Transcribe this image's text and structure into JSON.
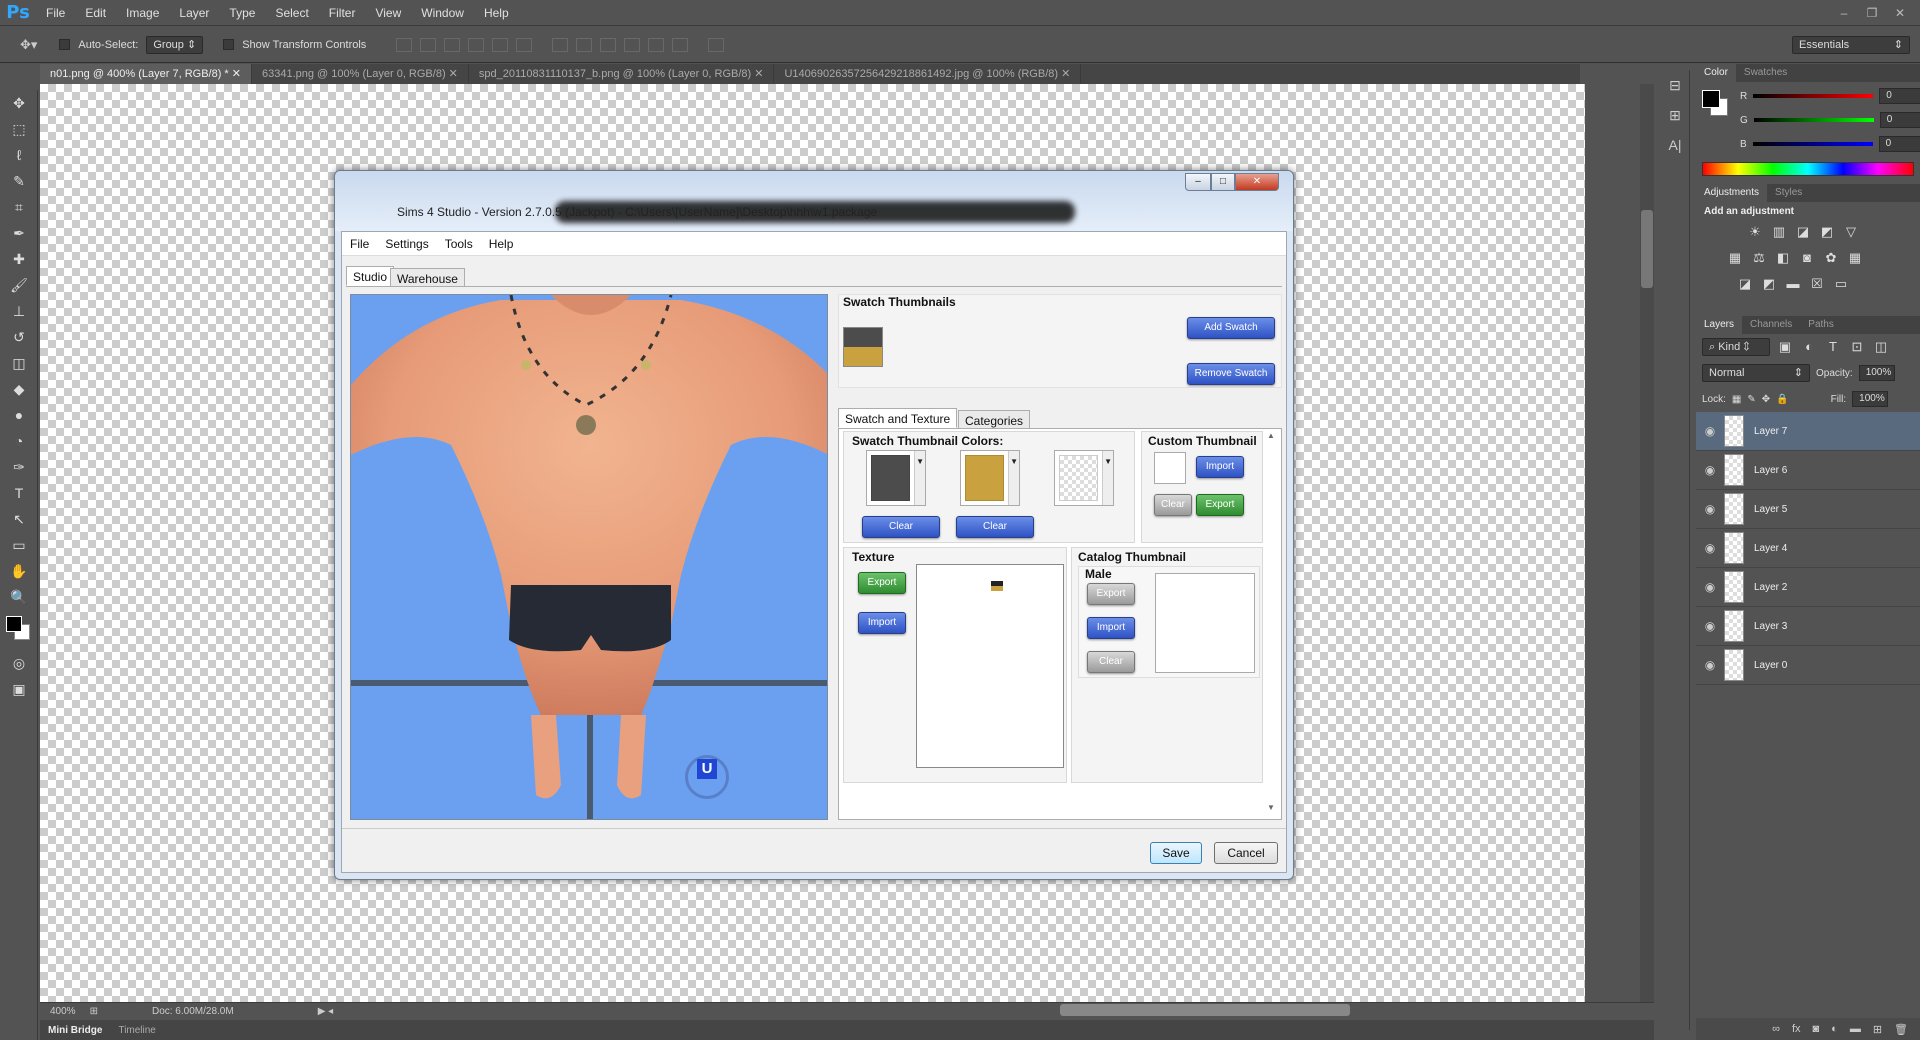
{
  "app": {
    "logo": "Ps",
    "menu": [
      "File",
      "Edit",
      "Image",
      "Layer",
      "Type",
      "Select",
      "Filter",
      "View",
      "Window",
      "Help"
    ],
    "window_controls": [
      "–",
      "❐",
      "✕"
    ]
  },
  "options_bar": {
    "auto_select_label": "Auto-Select:",
    "auto_select_value": "Group",
    "show_transform_label": "Show Transform Controls",
    "workspace": "Essentials"
  },
  "doc_tabs": [
    {
      "label": "n01.png @ 400% (Layer 7, RGB/8) *",
      "active": true
    },
    {
      "label": "63341.png @ 100% (Layer 0, RGB/8)",
      "active": false
    },
    {
      "label": "spd_20110831110137_b.png @ 100% (Layer 0, RGB/8)",
      "active": false
    },
    {
      "label": "U14069026357256429218861492.jpg @ 100% (RGB/8)",
      "active": false
    }
  ],
  "status": {
    "zoom": "400%",
    "doc": "Doc: 6.00M/28.0M"
  },
  "bottom_tabs": [
    "Mini Bridge",
    "Timeline"
  ],
  "color_panel": {
    "tabs": [
      "Color",
      "Swatches"
    ],
    "channels": [
      {
        "label": "R",
        "value": "0"
      },
      {
        "label": "G",
        "value": "0"
      },
      {
        "label": "B",
        "value": "0"
      }
    ]
  },
  "adjustments_panel": {
    "tabs": [
      "Adjustments",
      "Styles"
    ],
    "heading": "Add an adjustment"
  },
  "layers_panel": {
    "tabs": [
      "Layers",
      "Channels",
      "Paths"
    ],
    "kind": "Kind",
    "blend_mode": "Normal",
    "opacity_label": "Opacity:",
    "opacity": "100%",
    "lock_label": "Lock:",
    "fill_label": "Fill:",
    "fill": "100%",
    "layers": [
      {
        "name": "Layer 7",
        "active": true
      },
      {
        "name": "Layer 6",
        "active": false
      },
      {
        "name": "Layer 5",
        "active": false
      },
      {
        "name": "Layer 4",
        "active": false
      },
      {
        "name": "Layer 2",
        "active": false
      },
      {
        "name": "Layer 3",
        "active": false
      },
      {
        "name": "Layer 0",
        "active": false
      }
    ]
  },
  "s4s": {
    "title": "Sims 4 Studio - Version 2.7.0.5 (Jackpot) - C:\\Users\\[UserName]\\Desktop\\hhh\\w1.package",
    "menu": [
      "File",
      "Settings",
      "Tools",
      "Help"
    ],
    "main_tabs": [
      {
        "label": "Studio",
        "active": true
      },
      {
        "label": "Warehouse",
        "active": false
      }
    ],
    "swatch_thumbnails": "Swatch Thumbnails",
    "add_swatch": "Add Swatch",
    "remove_swatch": "Remove Swatch",
    "inner_tabs": [
      {
        "label": "Swatch and Texture",
        "active": true
      },
      {
        "label": "Categories",
        "active": false
      }
    ],
    "swatch_colors_label": "Swatch Thumbnail Colors:",
    "swatch_colors": [
      "#4c4c4c",
      "#c9a13f"
    ],
    "clear": "Clear",
    "custom_thumbnail": "Custom Thumbnail",
    "import": "Import",
    "export": "Export",
    "texture": "Texture",
    "catalog_thumbnail": "Catalog Thumbnail",
    "male": "Male",
    "save": "Save",
    "cancel": "Cancel",
    "watermark_letter": "U"
  }
}
